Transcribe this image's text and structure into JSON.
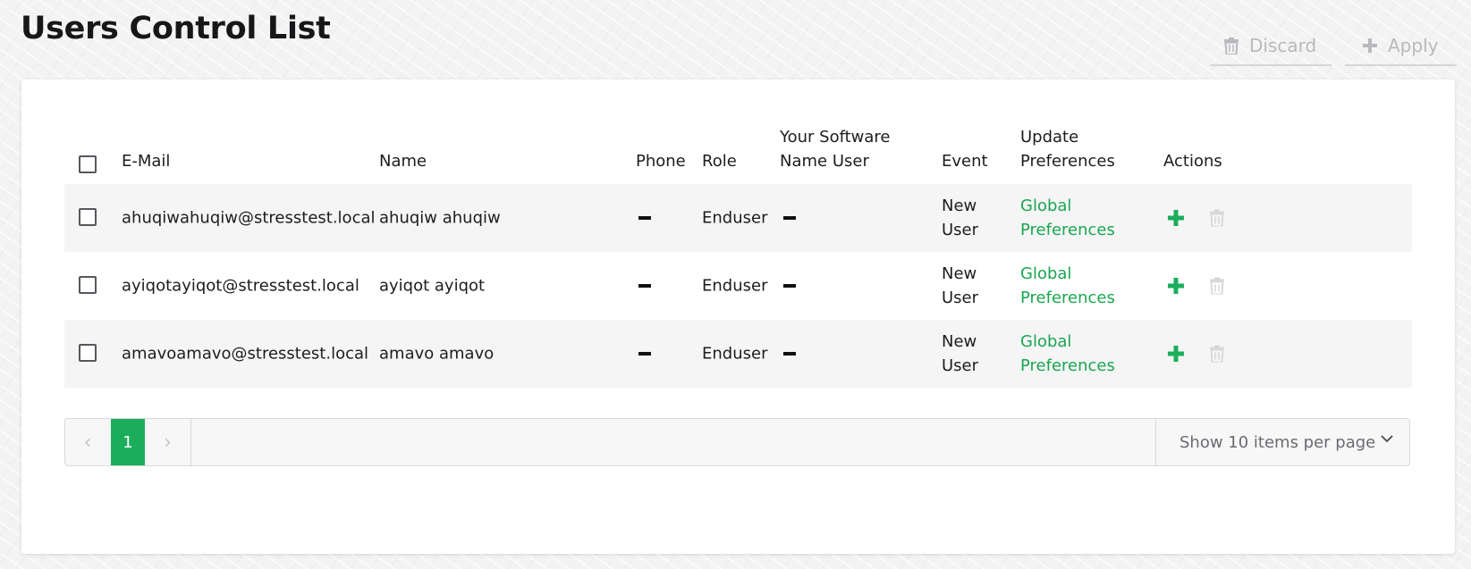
{
  "page_title": "Users Control List",
  "toolbar": {
    "discard_label": "Discard",
    "apply_label": "Apply"
  },
  "table": {
    "headers": {
      "email": "E-Mail",
      "name": "Name",
      "phone": "Phone",
      "role": "Role",
      "software_user_line1": "Your Software",
      "software_user_line2": "Name User",
      "event": "Event",
      "update_prefs_line1": "Update",
      "update_prefs_line2": "Preferences",
      "actions": "Actions"
    },
    "rows": [
      {
        "email": "ahuqiwahuqiw@stresstest.local",
        "name": "ahuqiw ahuqiw",
        "role": "Enduser",
        "event_line1": "New",
        "event_line2": "User",
        "prefs_line1": "Global",
        "prefs_line2": "Preferences"
      },
      {
        "email": "ayiqotayiqot@stresstest.local",
        "name": "ayiqot ayiqot",
        "role": "Enduser",
        "event_line1": "New",
        "event_line2": "User",
        "prefs_line1": "Global",
        "prefs_line2": "Preferences"
      },
      {
        "email": "amavoamavo@stresstest.local",
        "name": "amavo amavo",
        "role": "Enduser",
        "event_line1": "New",
        "event_line2": "User",
        "prefs_line1": "Global",
        "prefs_line2": "Preferences"
      }
    ]
  },
  "pagination": {
    "current_page": "1",
    "prev_symbol": "‹",
    "next_symbol": "›",
    "per_page_label": "Show 10 items per page"
  },
  "icons": {
    "discard": "trash-icon",
    "apply": "plus-icon",
    "add_action": "plus-icon",
    "delete_action": "trash-icon",
    "per_page": "chevron-down-icon"
  },
  "colors": {
    "accent_green": "#1aae5c",
    "link_green": "#1aa651",
    "disabled_gray": "#b9b9bd"
  }
}
